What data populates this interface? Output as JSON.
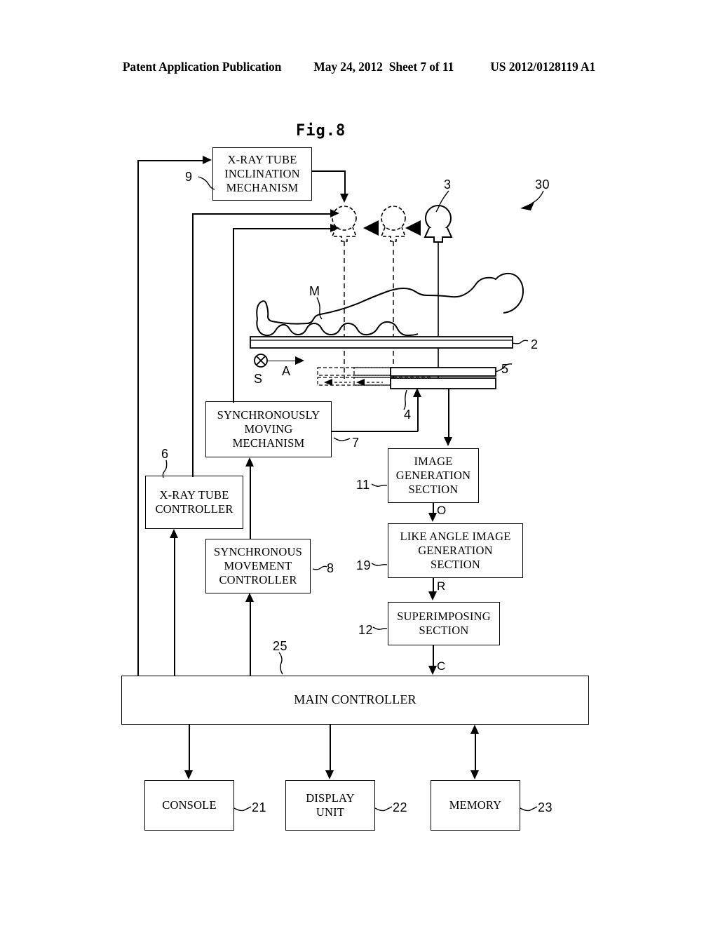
{
  "header": {
    "publication": "Patent Application Publication",
    "date": "May 24, 2012",
    "sheet": "Sheet 7 of 11",
    "number": "US 2012/0128119 A1"
  },
  "figure": {
    "title": "Fig.8",
    "system_ref": "30"
  },
  "boxes": [
    {
      "id": "xray-tube-inclination-mechanism",
      "label": "X-RAY TUBE\nINCLINATION\nMECHANISM",
      "ref": "9"
    },
    {
      "id": "synchronously-moving-mechanism",
      "label": "SYNCHRONOUSLY\nMOVING\nMECHANISM",
      "ref": "7"
    },
    {
      "id": "xray-tube-controller",
      "label": "X-RAY TUBE\nCONTROLLER",
      "ref": "6"
    },
    {
      "id": "synchronous-movement-controller",
      "label": "SYNCHRONOUS\nMOVEMENT\nCONTROLLER",
      "ref": "8"
    },
    {
      "id": "image-generation-section",
      "label": "IMAGE\nGENERATION\nSECTION",
      "ref": "11"
    },
    {
      "id": "like-angle-image-generation-section",
      "label": "LIKE ANGLE IMAGE\nGENERATION\nSECTION",
      "ref": "19"
    },
    {
      "id": "superimposing-section",
      "label": "SUPERIMPOSING\nSECTION",
      "ref": "12"
    },
    {
      "id": "main-controller",
      "label": "MAIN CONTROLLER",
      "ref": "25"
    },
    {
      "id": "console",
      "label": "CONSOLE",
      "ref": "21"
    },
    {
      "id": "display-unit",
      "label": "DISPLAY\nUNIT",
      "ref": "22"
    },
    {
      "id": "memory",
      "label": "MEMORY",
      "ref": "23"
    }
  ],
  "box_text": {
    "xray_tube_inclination_mechanism": {
      "line1": "X-RAY TUBE",
      "line2": "INCLINATION",
      "line3": "MECHANISM"
    },
    "synchronously_moving_mechanism": {
      "line1": "SYNCHRONOUSLY",
      "line2": "MOVING",
      "line3": "MECHANISM"
    },
    "xray_tube_controller": {
      "line1": "X-RAY TUBE",
      "line2": "CONTROLLER"
    },
    "synchronous_movement_controller": {
      "line1": "SYNCHRONOUS",
      "line2": "MOVEMENT",
      "line3": "CONTROLLER"
    },
    "image_generation_section": {
      "line1": "IMAGE",
      "line2": "GENERATION",
      "line3": "SECTION"
    },
    "like_angle_image_generation_section": {
      "line1": "LIKE ANGLE IMAGE",
      "line2": "GENERATION",
      "line3": "SECTION"
    },
    "superimposing_section": {
      "line1": "SUPERIMPOSING",
      "line2": "SECTION"
    },
    "main_controller": {
      "line1": "MAIN CONTROLLER"
    },
    "console": {
      "line1": "CONSOLE"
    },
    "display_unit": {
      "line1": "DISPLAY",
      "line2": "UNIT"
    },
    "memory": {
      "line1": "MEMORY"
    }
  },
  "refs": {
    "r9": "9",
    "r7": "7",
    "r6": "6",
    "r8": "8",
    "r11": "11",
    "r19": "19",
    "r12": "12",
    "r25": "25",
    "r21": "21",
    "r22": "22",
    "r23": "23",
    "r3": "3",
    "r30": "30",
    "r2": "2",
    "r4": "4",
    "r5": "5"
  },
  "signals": {
    "o": "O",
    "r": "R",
    "c": "C"
  },
  "markers": {
    "subject": "M",
    "direction_s": "S",
    "direction_a": "A"
  },
  "colors": {
    "line": "#000000",
    "background": "#ffffff"
  }
}
